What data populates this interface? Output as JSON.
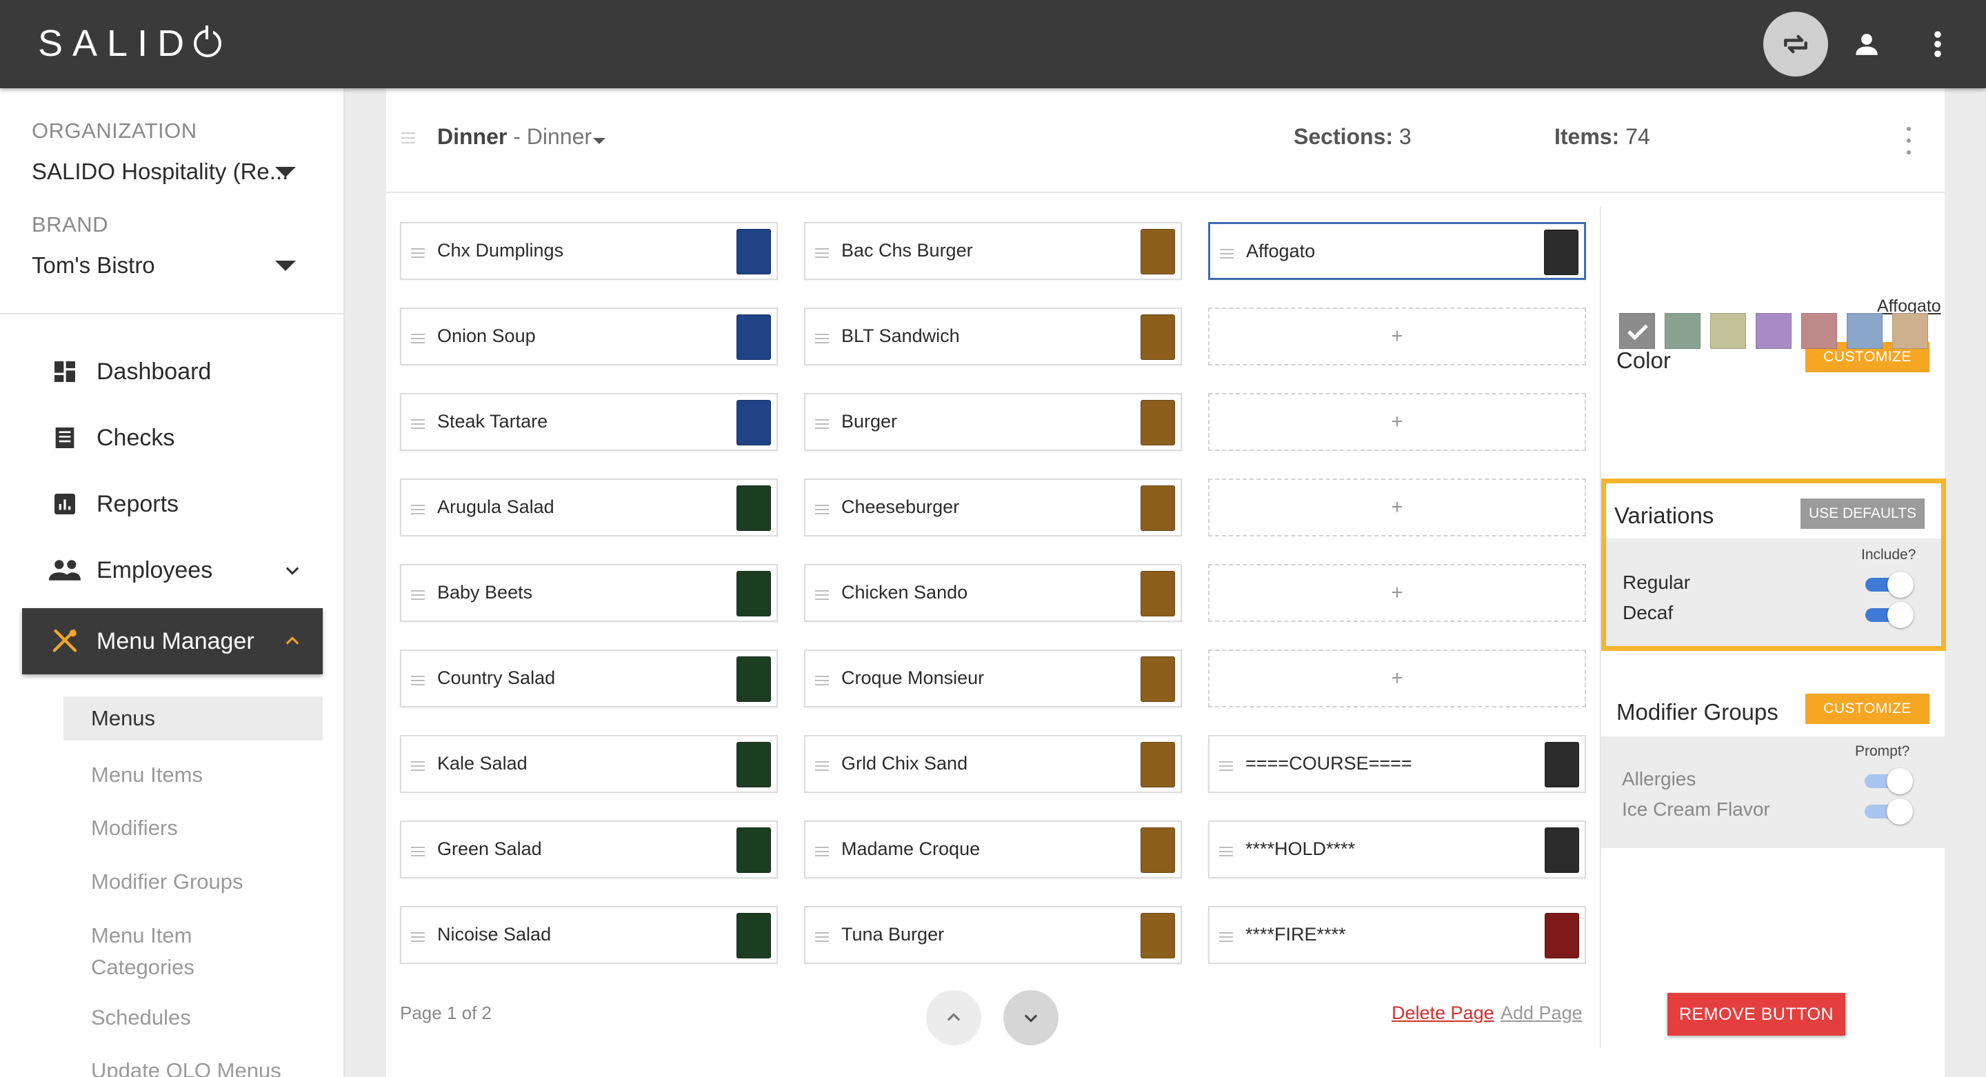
{
  "app": {
    "logo": "SALID",
    "logo_tail": "O"
  },
  "sidebar": {
    "org_label": "ORGANIZATION",
    "org_value": "SALIDO Hospitality (Re...",
    "brand_label": "BRAND",
    "brand_value": "Tom's Bistro",
    "nav": [
      {
        "label": "Dashboard",
        "icon": "dashboard-icon"
      },
      {
        "label": "Checks",
        "icon": "receipt-icon"
      },
      {
        "label": "Reports",
        "icon": "bar-chart-icon"
      },
      {
        "label": "Employees",
        "icon": "people-icon"
      },
      {
        "label": "Menu Manager",
        "icon": "utensils-icon"
      }
    ],
    "subnav": [
      "Menus",
      "Menu Items",
      "Modifiers",
      "Modifier Groups",
      "Menu Item Categories",
      "Schedules",
      "Update OLO Menus"
    ]
  },
  "menu_header": {
    "title": "Dinner",
    "subtitle": " - Dinner",
    "sections_label": "Sections:",
    "sections_value": "3",
    "items_label": "Items:",
    "items_value": "74"
  },
  "grid": {
    "col1": [
      {
        "name": "Chx Dumplings",
        "color": "#1f4386"
      },
      {
        "name": "Onion Soup",
        "color": "#1f4386"
      },
      {
        "name": "Steak Tartare",
        "color": "#1f4386"
      },
      {
        "name": "Arugula Salad",
        "color": "#1d3d22"
      },
      {
        "name": "Baby Beets",
        "color": "#1d3d22"
      },
      {
        "name": "Country Salad",
        "color": "#1d3d22"
      },
      {
        "name": "Kale Salad",
        "color": "#1d3d22"
      },
      {
        "name": "Green Salad",
        "color": "#1d3d22"
      },
      {
        "name": "Nicoise Salad",
        "color": "#1d3d22"
      }
    ],
    "col2": [
      {
        "name": "Bac Chs Burger",
        "color": "#8c5f1d"
      },
      {
        "name": "BLT Sandwich",
        "color": "#8c5f1d"
      },
      {
        "name": "Burger",
        "color": "#8c5f1d"
      },
      {
        "name": "Cheeseburger",
        "color": "#8c5f1d"
      },
      {
        "name": "Chicken Sando",
        "color": "#8c5f1d"
      },
      {
        "name": "Croque Monsieur",
        "color": "#8c5f1d"
      },
      {
        "name": "Grld Chix Sand",
        "color": "#8c5f1d"
      },
      {
        "name": "Madame Croque",
        "color": "#8c5f1d"
      },
      {
        "name": "Tuna Burger",
        "color": "#8c5f1d"
      }
    ],
    "col3": [
      {
        "name": "Affogato",
        "color": "#2b2b2b"
      },
      {
        "name": "",
        "color": ""
      },
      {
        "name": "",
        "color": ""
      },
      {
        "name": "",
        "color": ""
      },
      {
        "name": "",
        "color": ""
      },
      {
        "name": "",
        "color": ""
      },
      {
        "name": "====COURSE====",
        "color": "#2b2b2b"
      },
      {
        "name": "****HOLD****",
        "color": "#2b2b2b"
      },
      {
        "name": "****FIRE****",
        "color": "#7e1a1a"
      }
    ],
    "add_symbol": "+"
  },
  "pager": {
    "text": "Page 1 of 2",
    "delete": "Delete Page",
    "add": "Add Page"
  },
  "detail": {
    "item_link": "Affogato",
    "color_heading": "Color",
    "customize": "CUSTOMIZE",
    "swatches": [
      "#8c8c8c",
      "#8aa292",
      "#c3c197",
      "#a88bc4",
      "#c08a8c",
      "#8aa6c8",
      "#cdb08e"
    ],
    "variations_heading": "Variations",
    "use_defaults": "USE DEFAULTS",
    "include_label": "Include?",
    "variations": [
      "Regular",
      "Decaf"
    ],
    "modifier_heading": "Modifier Groups",
    "prompt_label": "Prompt?",
    "modifiers": [
      "Allergies",
      "Ice Cream Flavor"
    ],
    "remove": "REMOVE BUTTON"
  }
}
